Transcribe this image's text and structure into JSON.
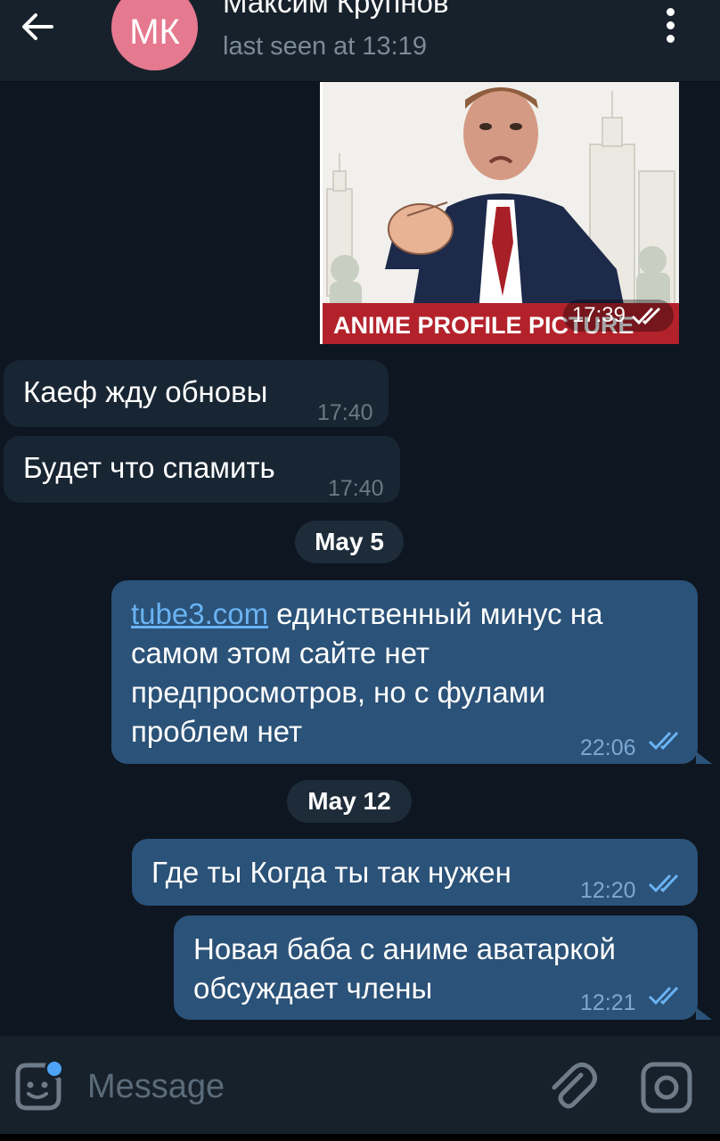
{
  "header": {
    "avatar_initials": "МК",
    "contact_name": "Максим Крупнов",
    "last_seen": "last seen at 13:19"
  },
  "image_message": {
    "banner_text": "ANIME PROFILE PICTURE",
    "time": "17:39"
  },
  "messages": [
    {
      "direction": "in",
      "text": "Каеф жду обновы",
      "time": "17:40"
    },
    {
      "direction": "in",
      "text": "Будет что спамить",
      "time": "17:40"
    },
    {
      "date_separator": "May 5"
    },
    {
      "direction": "out",
      "link": "tube3.com",
      "text_line1": " единственный минус на",
      "text_line2": "самом этом сайте нет",
      "text_line3": "предпросмотров, но с фулами",
      "text_line4": "проблем нет",
      "time": "22:06",
      "read": true
    },
    {
      "date_separator": "May 12"
    },
    {
      "direction": "out",
      "text": "Где ты Когда ты так нужен",
      "time": "12:20",
      "read": true
    },
    {
      "direction": "out",
      "text_line1": "Новая баба с аниме аватаркой",
      "text_line2": "обсуждает члены",
      "time": "12:21",
      "read": true
    }
  ],
  "input": {
    "placeholder": "Message"
  },
  "icons": [
    "back-arrow-icon",
    "more-vertical-icon",
    "sticker-icon",
    "paperclip-icon",
    "camera-icon",
    "double-check-icon"
  ],
  "colors": {
    "background": "#0e1621",
    "header": "#17212b",
    "incoming_bubble": "#182533",
    "outgoing_bubble": "#2b5278",
    "link": "#6ab3f3",
    "avatar": "#e5798f",
    "banner": "#b3222b"
  }
}
